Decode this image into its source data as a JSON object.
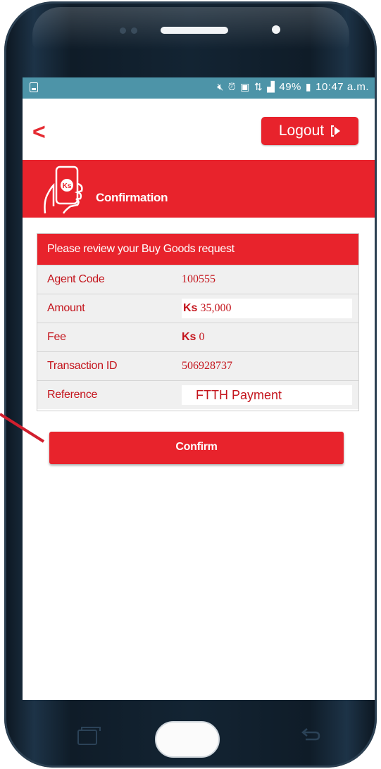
{
  "status_bar": {
    "icons": [
      "notification-icon",
      "mute-icon",
      "alarm-icon",
      "nfc-icon",
      "data-icon",
      "signal-icon"
    ],
    "battery_percent": "49%",
    "time": "10:47 a.m."
  },
  "header": {
    "back_label": "<",
    "logout_label": "Logout"
  },
  "banner": {
    "title": "Confirmation",
    "icon_text": "Ks"
  },
  "review": {
    "title": "Please review your Buy Goods request",
    "rows": [
      {
        "label": "Agent Code",
        "value": "100555"
      },
      {
        "label": "Amount",
        "currency": "Ks",
        "value": "35,000"
      },
      {
        "label": "Fee",
        "currency": "Ks",
        "value": "0"
      },
      {
        "label": "Transaction ID",
        "value": "506928737"
      },
      {
        "label": "Reference",
        "value": "FTTH Payment"
      }
    ]
  },
  "actions": {
    "confirm_label": "Confirm"
  },
  "colors": {
    "brand_red": "#e8232c",
    "status_bar": "#4d94a8",
    "label_red": "#c4141c",
    "annotation": "#d11f2e"
  }
}
